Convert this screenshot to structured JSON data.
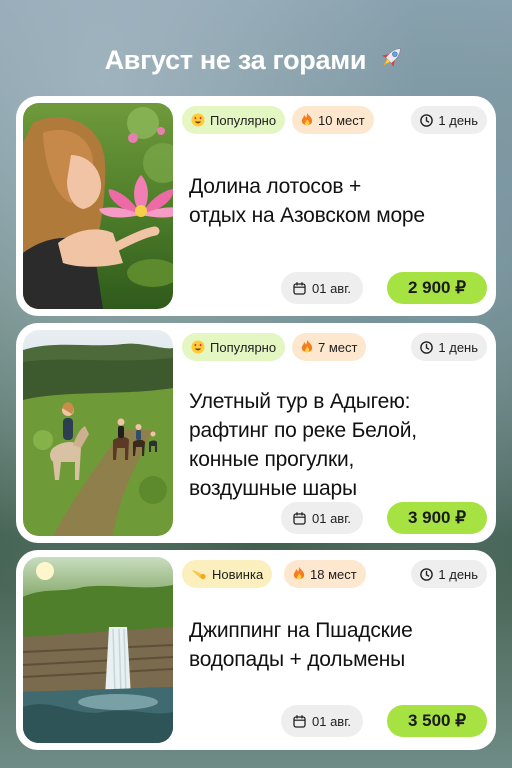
{
  "heading": {
    "title": "Август не за горами",
    "emoji": "rocket-icon"
  },
  "colors": {
    "price_bg": "#a7e243",
    "popular_bg": "#e4f6c2",
    "places_bg": "#fde7cf",
    "new_bg": "#fbf0bd"
  },
  "tours": [
    {
      "badge_primary": {
        "icon": "heart-eyes-emoji",
        "label": "Популярно"
      },
      "places": {
        "icon": "fire-emoji",
        "label": "10 мест"
      },
      "duration": {
        "icon": "clock-icon",
        "label": "1 день"
      },
      "title_lines": [
        "Долина лотосов +",
        "отдых на Азовском море"
      ],
      "date": "01 авг.",
      "price": "2 900 ₽",
      "image": "woman-with-lotus-flower-photo"
    },
    {
      "badge_primary": {
        "icon": "heart-eyes-emoji",
        "label": "Популярно"
      },
      "places": {
        "icon": "fire-emoji",
        "label": "7 мест"
      },
      "duration": {
        "icon": "clock-icon",
        "label": "1 день"
      },
      "title_lines": [
        "Улетный тур в Адыгею:",
        "рафтинг по реке Белой,",
        "конные прогулки,",
        "воздушные шары"
      ],
      "date": "01 авг.",
      "price": "3 900 ₽",
      "image": "horse-riders-in-mountains-photo"
    },
    {
      "badge_primary": {
        "icon": "comet-emoji",
        "label": "Новинка"
      },
      "places": {
        "icon": "fire-emoji",
        "label": "18 мест"
      },
      "duration": {
        "icon": "clock-icon",
        "label": "1 день"
      },
      "title_lines": [
        "Джиппинг на Пшадские",
        "водопады + дольмены"
      ],
      "date": "01 авг.",
      "price": "3 500 ₽",
      "image": "forest-waterfall-photo"
    }
  ]
}
